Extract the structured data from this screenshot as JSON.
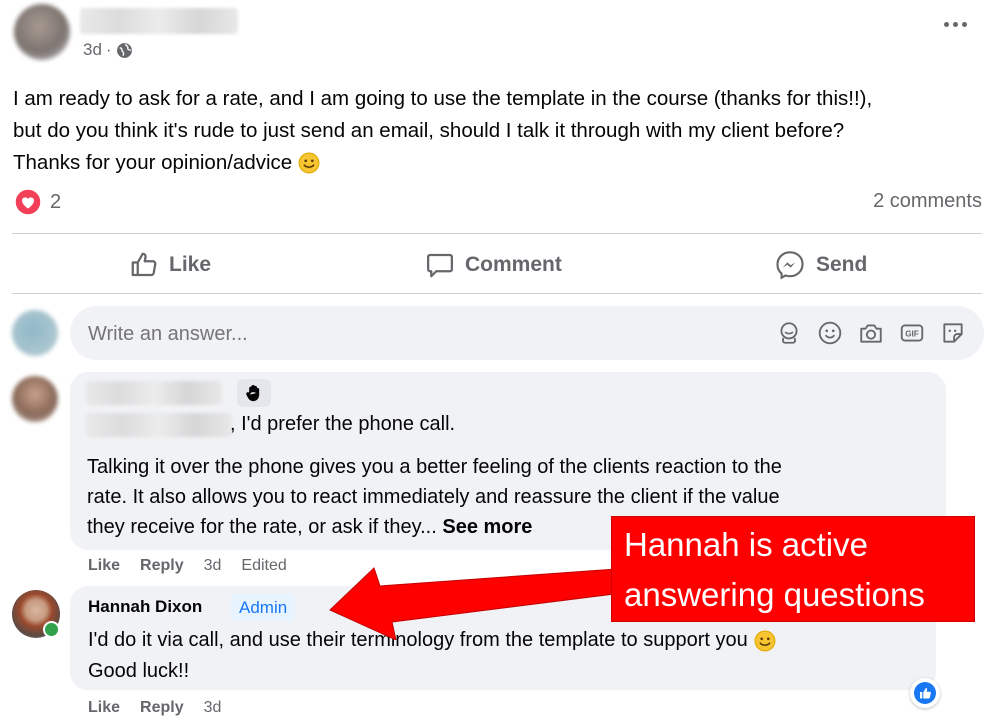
{
  "post": {
    "time": "3d",
    "separator": "·",
    "privacy_icon": "globe-icon",
    "text_lines": [
      "I am ready to ask for a rate, and I am going to use the template in the course (thanks for this!!),",
      "but do you think it's rude to just send an email, should I talk it through with my client before?",
      "Thanks for your opinion/advice"
    ],
    "more_icon": "more-options-icon",
    "reaction_count": "2",
    "comments_count": "2 comments"
  },
  "actions": {
    "like": "Like",
    "comment": "Comment",
    "send": "Send"
  },
  "composer": {
    "placeholder": "Write an answer...",
    "icons": [
      "avatar-sticker-icon",
      "emoji-icon",
      "camera-icon",
      "gif-icon",
      "sticker-icon"
    ]
  },
  "comment1": {
    "badge_icon": "waving-hand-icon",
    "line1_text": ", I'd prefer the phone call.",
    "body_lines": [
      "Talking it over the phone gives you a better feeling of the clients reaction to the",
      "rate. It also allows you to react immediately and reassure the client if the value",
      "they receive for the rate, or ask if they..."
    ],
    "see_more": "See more",
    "like": "Like",
    "reply": "Reply",
    "time": "3d",
    "edited": "Edited"
  },
  "comment2": {
    "name": "Hannah Dixon",
    "badge": "Admin",
    "line1": "I'd do it via call, and use their terminology from the template to support you",
    "line2": "Good luck!!",
    "like": "Like",
    "reply": "Reply",
    "time": "3d"
  },
  "annotation": {
    "line1": "Hannah is active",
    "line2": "answering questions",
    "color": "#ff0000"
  },
  "colors": {
    "accent": "#1877f2",
    "heart": "#f33e58",
    "muted": "#65676b",
    "bubble": "#f0f2f5"
  }
}
